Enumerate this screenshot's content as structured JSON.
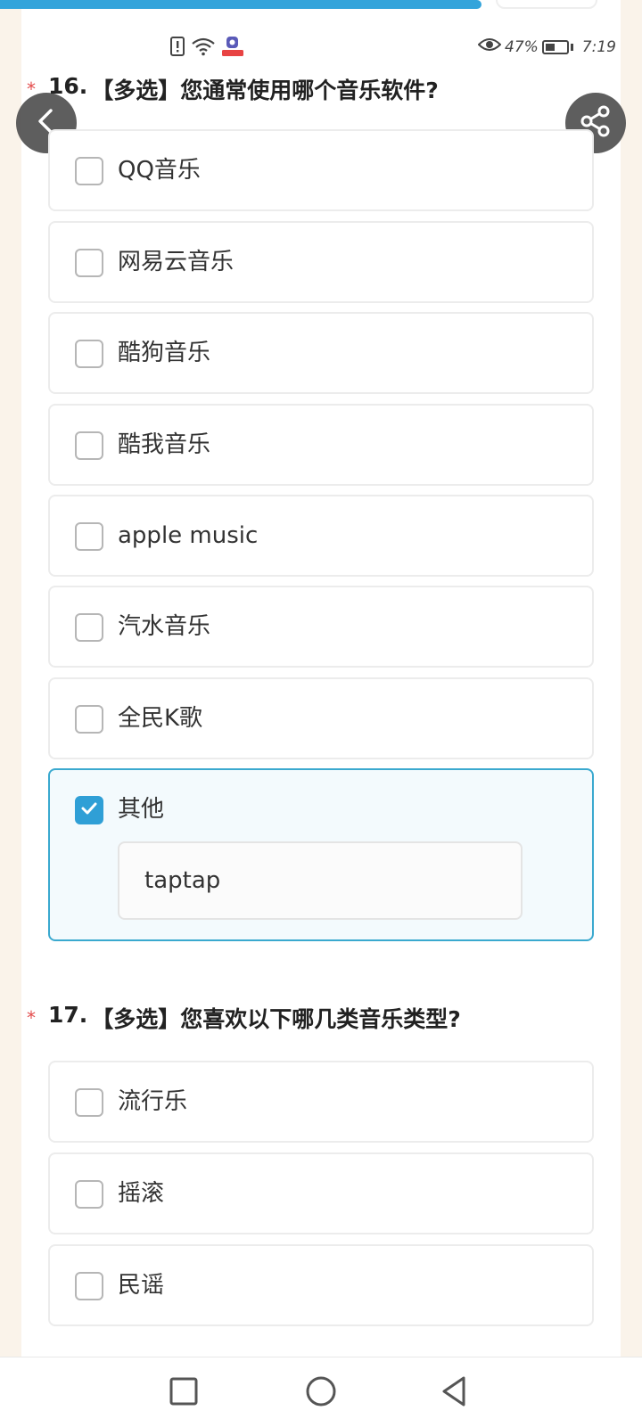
{
  "progress": {
    "fraction": 0.75,
    "color": "#33a4db"
  },
  "status_bar": {
    "battery_percent": "47%",
    "time": "7:19",
    "battery_level": 0.47,
    "left_icons": [
      "alert-icon",
      "wifi-icon",
      "app-notification-icon"
    ],
    "right_icons": [
      "eye-icon",
      "battery-icon"
    ]
  },
  "floating_buttons": {
    "back_icon": "chevron-left-icon",
    "share_icon": "share-icon"
  },
  "questions": [
    {
      "required_mark": "*",
      "number": "16.",
      "title": "【多选】您通常使用哪个音乐软件?",
      "options": [
        {
          "label": "QQ音乐",
          "checked": false
        },
        {
          "label": "网易云音乐",
          "checked": false
        },
        {
          "label": "酷狗音乐",
          "checked": false
        },
        {
          "label": "酷我音乐",
          "checked": false
        },
        {
          "label": "apple music",
          "checked": false
        },
        {
          "label": "汽水音乐",
          "checked": false
        },
        {
          "label": "全民K歌",
          "checked": false
        },
        {
          "label": "其他",
          "checked": true,
          "input_value": "taptap"
        }
      ]
    },
    {
      "required_mark": "*",
      "number": "17.",
      "title": "【多选】您喜欢以下哪几类音乐类型?",
      "options": [
        {
          "label": "流行乐",
          "checked": false
        },
        {
          "label": "摇滚",
          "checked": false
        },
        {
          "label": "民谣",
          "checked": false
        }
      ]
    }
  ],
  "colors": {
    "accent": "#2f9fd6",
    "selected_border": "#3aa9cf",
    "selected_background": "#f3fafd",
    "required_star": "#e34b4b",
    "side_background": "#faf3ea"
  },
  "nav_bar": {
    "icons": [
      "recent-apps-icon",
      "home-icon",
      "back-icon"
    ]
  }
}
